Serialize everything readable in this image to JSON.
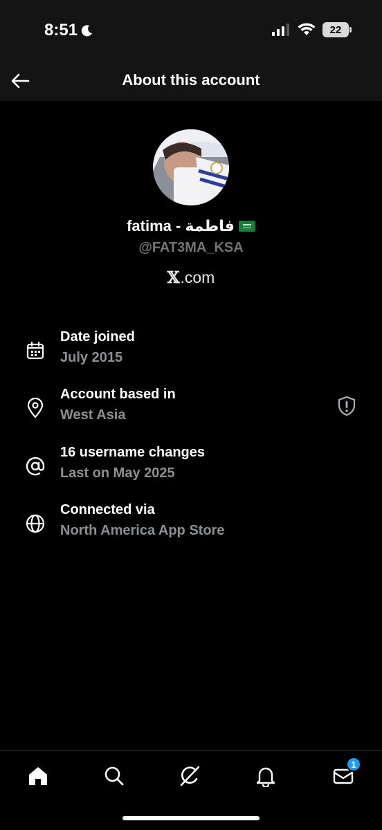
{
  "status_bar": {
    "time": "8:51",
    "battery": "22",
    "moon_icon": "moon-icon",
    "signal_icon": "signal-icon",
    "wifi_icon": "wifi-icon"
  },
  "header": {
    "title": "About this account",
    "back_icon": "arrow-left-icon"
  },
  "profile": {
    "display_name": "fatima - فاطمة",
    "flag_icon": "saudi-flag-icon",
    "handle": "@FAT3MA_KSA",
    "site_x": "𝕏",
    "site_rest": ".com"
  },
  "info_rows": [
    {
      "icon": "calendar-icon",
      "title": "Date joined",
      "subtitle": "July 2015"
    },
    {
      "icon": "location-pin-icon",
      "title": "Account based in",
      "subtitle": "West Asia",
      "trailing_icon": "shield-icon"
    },
    {
      "icon": "at-sign-icon",
      "title": "16 username changes",
      "subtitle": "Last on May 2025"
    },
    {
      "icon": "globe-icon",
      "title": "Connected via",
      "subtitle": "North America App Store"
    }
  ],
  "tab_bar": {
    "tabs": [
      {
        "name": "home",
        "icon": "home-icon"
      },
      {
        "name": "search",
        "icon": "search-icon"
      },
      {
        "name": "grok",
        "icon": "grok-icon"
      },
      {
        "name": "notifications",
        "icon": "bell-icon"
      },
      {
        "name": "messages",
        "icon": "mail-icon",
        "badge": "1"
      }
    ]
  },
  "colors": {
    "background": "#000000",
    "header_bg": "#141414",
    "secondary_text": "#8b9095",
    "accent": "#1d9bf0"
  }
}
